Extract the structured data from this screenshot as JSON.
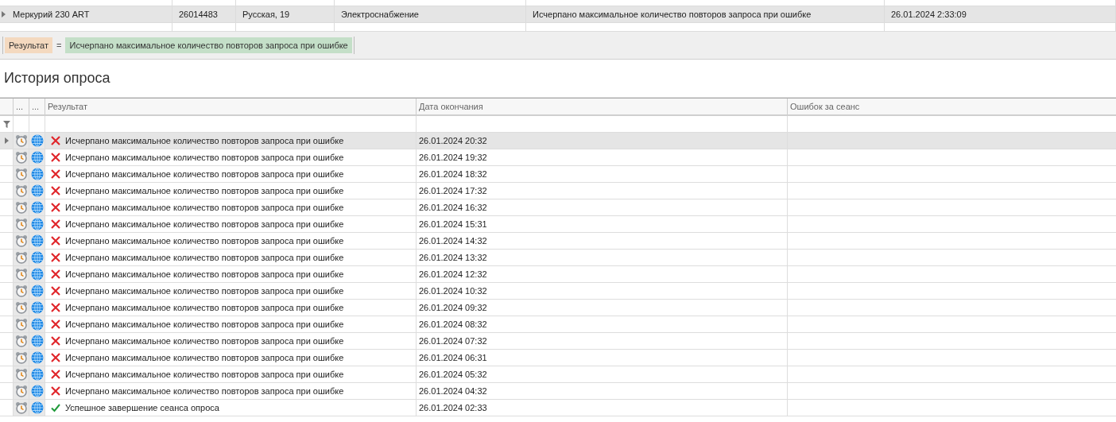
{
  "top_table": {
    "rows": [
      {
        "selected": true,
        "cells": [
          "Меркурий 230 ART",
          "26014483",
          "Русская, 19",
          "Электроснабжение",
          "Исчерпано максимальное количество повторов запроса при ошибке",
          "26.01.2024 2:33:09"
        ]
      }
    ]
  },
  "filter": {
    "field": "Результат",
    "operator": "=",
    "value": "Исчерпано максимальное количество повторов запроса при ошибке"
  },
  "history": {
    "title": "История опроса",
    "columns": [
      "...",
      "...",
      "Результат",
      "Дата окончания",
      "Ошибок за сеанс"
    ],
    "rows": [
      {
        "selected": true,
        "kind": "error",
        "result": "Исчерпано максимальное количество повторов запроса при ошибке",
        "end": "26.01.2024 20:32"
      },
      {
        "selected": false,
        "kind": "error",
        "result": "Исчерпано максимальное количество повторов запроса при ошибке",
        "end": "26.01.2024 19:32"
      },
      {
        "selected": false,
        "kind": "error",
        "result": "Исчерпано максимальное количество повторов запроса при ошибке",
        "end": "26.01.2024 18:32"
      },
      {
        "selected": false,
        "kind": "error",
        "result": "Исчерпано максимальное количество повторов запроса при ошибке",
        "end": "26.01.2024 17:32"
      },
      {
        "selected": false,
        "kind": "error",
        "result": "Исчерпано максимальное количество повторов запроса при ошибке",
        "end": "26.01.2024 16:32"
      },
      {
        "selected": false,
        "kind": "error",
        "result": "Исчерпано максимальное количество повторов запроса при ошибке",
        "end": "26.01.2024 15:31"
      },
      {
        "selected": false,
        "kind": "error",
        "result": "Исчерпано максимальное количество повторов запроса при ошибке",
        "end": "26.01.2024 14:32"
      },
      {
        "selected": false,
        "kind": "error",
        "result": "Исчерпано максимальное количество повторов запроса при ошибке",
        "end": "26.01.2024 13:32"
      },
      {
        "selected": false,
        "kind": "error",
        "result": "Исчерпано максимальное количество повторов запроса при ошибке",
        "end": "26.01.2024 12:32"
      },
      {
        "selected": false,
        "kind": "error",
        "result": "Исчерпано максимальное количество повторов запроса при ошибке",
        "end": "26.01.2024 10:32"
      },
      {
        "selected": false,
        "kind": "error",
        "result": "Исчерпано максимальное количество повторов запроса при ошибке",
        "end": "26.01.2024 09:32"
      },
      {
        "selected": false,
        "kind": "error",
        "result": "Исчерпано максимальное количество повторов запроса при ошибке",
        "end": "26.01.2024 08:32"
      },
      {
        "selected": false,
        "kind": "error",
        "result": "Исчерпано максимальное количество повторов запроса при ошибке",
        "end": "26.01.2024 07:32"
      },
      {
        "selected": false,
        "kind": "error",
        "result": "Исчерпано максимальное количество повторов запроса при ошибке",
        "end": "26.01.2024 06:31"
      },
      {
        "selected": false,
        "kind": "error",
        "result": "Исчерпано максимальное количество повторов запроса при ошибке",
        "end": "26.01.2024 05:32"
      },
      {
        "selected": false,
        "kind": "error",
        "result": "Исчерпано максимальное количество повторов запроса при ошибке",
        "end": "26.01.2024 04:32"
      },
      {
        "selected": false,
        "kind": "success",
        "result": "Успешное завершение сеанса опроса",
        "end": "26.01.2024 02:33"
      }
    ]
  }
}
